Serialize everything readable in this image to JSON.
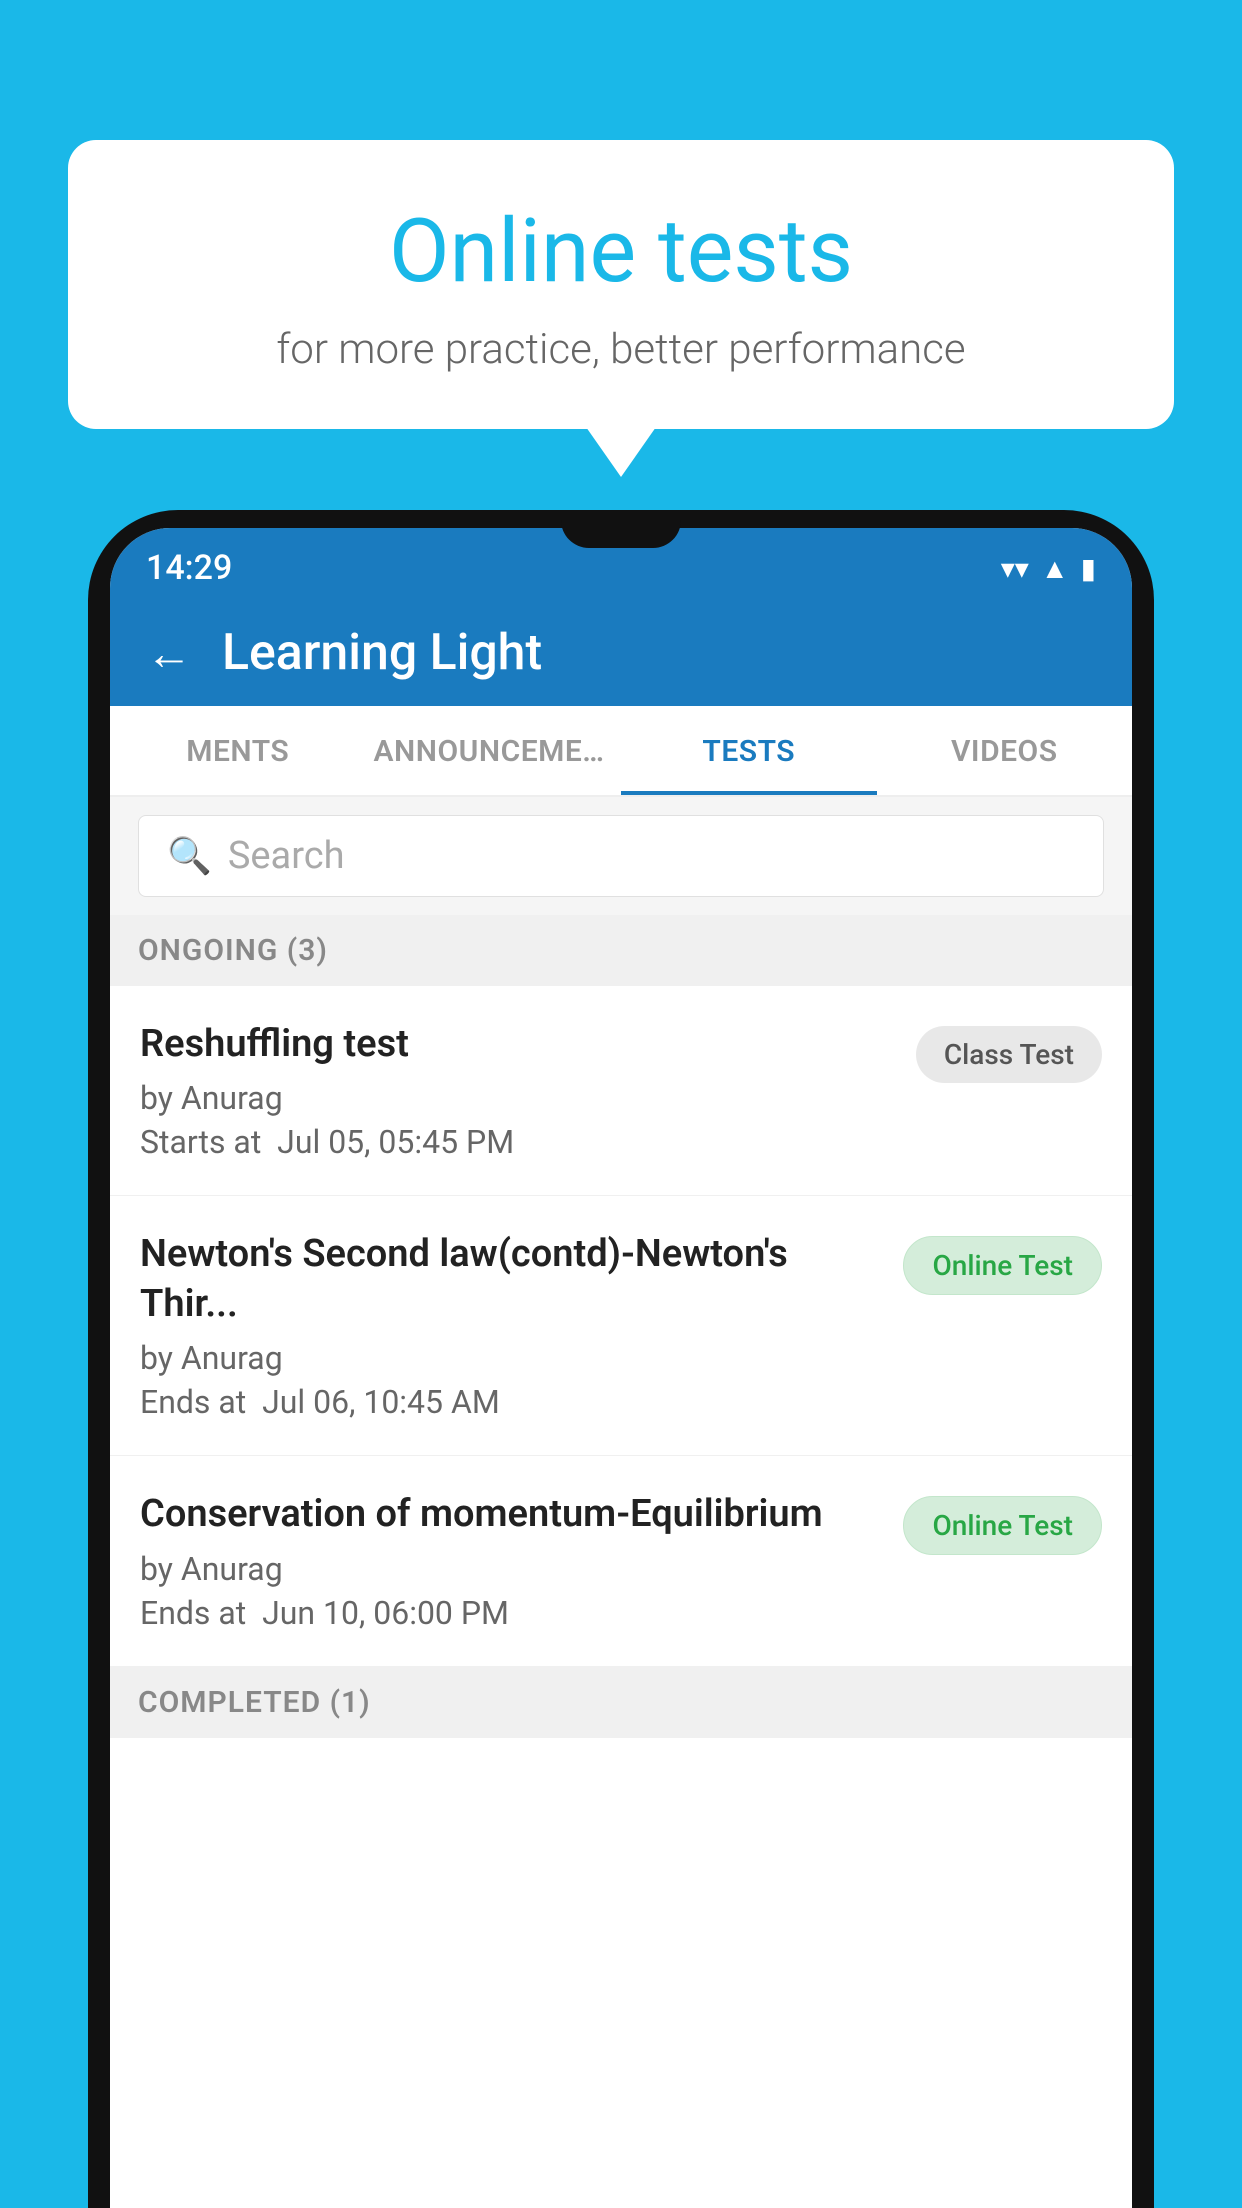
{
  "background_color": "#1ab8e8",
  "bubble": {
    "title": "Online tests",
    "subtitle": "for more practice, better performance"
  },
  "phone": {
    "status_bar": {
      "time": "14:29",
      "wifi_icon": "wifi",
      "signal_icon": "signal",
      "battery_icon": "battery"
    },
    "app_bar": {
      "back_label": "←",
      "title": "Learning Light"
    },
    "tabs": [
      {
        "label": "MENTS",
        "active": false
      },
      {
        "label": "ANNOUNCEMENTS",
        "active": false
      },
      {
        "label": "TESTS",
        "active": true
      },
      {
        "label": "VIDEOS",
        "active": false
      }
    ],
    "search": {
      "placeholder": "Search"
    },
    "ongoing_section": {
      "label": "ONGOING (3)",
      "tests": [
        {
          "name": "Reshuffling test",
          "author": "by Anurag",
          "date_label": "Starts at",
          "date": "Jul 05, 05:45 PM",
          "badge": "Class Test",
          "badge_type": "class"
        },
        {
          "name": "Newton's Second law(contd)-Newton's Thir...",
          "author": "by Anurag",
          "date_label": "Ends at",
          "date": "Jul 06, 10:45 AM",
          "badge": "Online Test",
          "badge_type": "online"
        },
        {
          "name": "Conservation of momentum-Equilibrium",
          "author": "by Anurag",
          "date_label": "Ends at",
          "date": "Jun 10, 06:00 PM",
          "badge": "Online Test",
          "badge_type": "online"
        }
      ]
    },
    "completed_section": {
      "label": "COMPLETED (1)"
    }
  }
}
